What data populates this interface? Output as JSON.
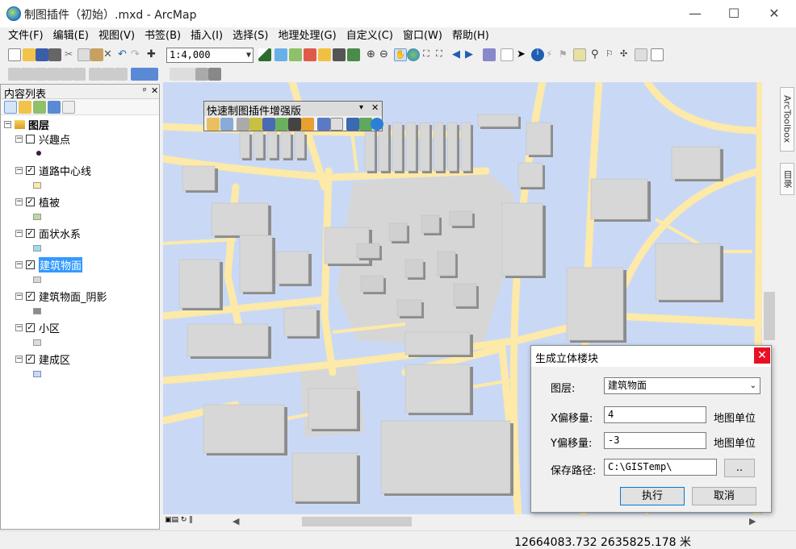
{
  "window": {
    "title": "制图插件（初始）.mxd - ArcMap",
    "minimize": "—",
    "maximize": "☐",
    "close": "✕"
  },
  "menu": [
    "文件(F)",
    "编辑(E)",
    "视图(V)",
    "书签(B)",
    "插入(I)",
    "选择(S)",
    "地理处理(G)",
    "自定义(C)",
    "窗口(W)",
    "帮助(H)"
  ],
  "toolbar": {
    "scale": "1:4,000"
  },
  "toc": {
    "title": "内容列表",
    "pin": "ᵖ",
    "close": "✕",
    "root": "图层",
    "layers": [
      {
        "name": "兴趣点",
        "checked": false,
        "swatch": "#3b1a4d"
      },
      {
        "name": "道路中心线",
        "checked": true,
        "swatch": "#fde9a8"
      },
      {
        "name": "植被",
        "checked": true,
        "swatch": "#b8dca0"
      },
      {
        "name": "面状水系",
        "checked": true,
        "swatch": "#99ddf5"
      },
      {
        "name": "建筑物面",
        "checked": true,
        "swatch": "#d7d7d7"
      },
      {
        "name": "建筑物面_阴影",
        "checked": true,
        "swatch": "#8c8c8c"
      },
      {
        "name": "小区",
        "checked": true,
        "swatch": "#dcdcdc"
      },
      {
        "name": "建成区",
        "checked": true,
        "swatch": "#c9d9f5"
      }
    ]
  },
  "quick_toolbar": {
    "title": "快速制图插件增强版"
  },
  "dialog": {
    "title": "生成立体楼块",
    "layer_label": "图层:",
    "layer_value": "建筑物面",
    "x_label": "X偏移量:",
    "x_value": "4",
    "y_label": "Y偏移量:",
    "y_value": "-3",
    "unit": "地图单位",
    "path_label": "保存路径:",
    "path_value": "C:\\GISTemp\\",
    "browse": "..",
    "ok": "执行",
    "cancel": "取消"
  },
  "dock": {
    "arctoolbox": "ArcToolbox",
    "catalog": "目录"
  },
  "status": {
    "coords": "12664083.732  2635825.178 米"
  }
}
